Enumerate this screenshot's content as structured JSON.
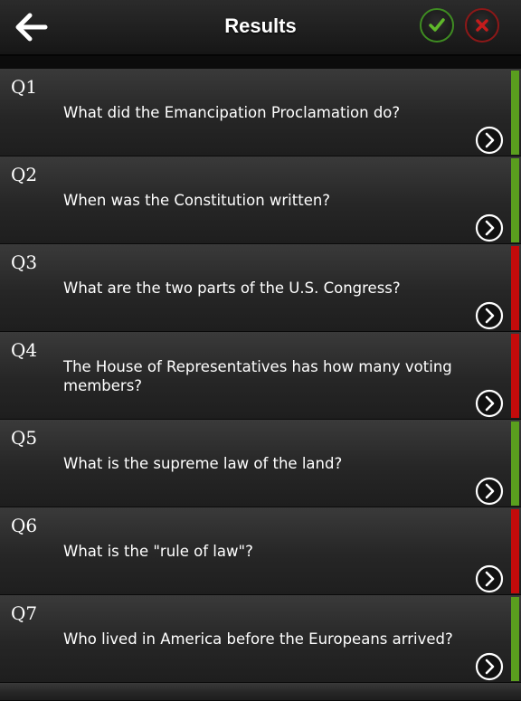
{
  "header": {
    "title": "Results",
    "back_icon": "arrow-left-icon",
    "correct_icon": "checkmark-icon",
    "wrong_icon": "x-icon"
  },
  "colors": {
    "correct": "#5a9e1e",
    "wrong": "#c30b0b"
  },
  "questions": [
    {
      "num": "Q1",
      "text": "What did the Emancipation Proclamation do?",
      "status": "correct"
    },
    {
      "num": "Q2",
      "text": "When was the Constitution written?",
      "status": "correct"
    },
    {
      "num": "Q3",
      "text": "What are the two parts of the U.S. Congress?",
      "status": "wrong"
    },
    {
      "num": "Q4",
      "text": "The House of Representatives has how many voting members?",
      "status": "wrong"
    },
    {
      "num": "Q5",
      "text": "What is the supreme law of the land?",
      "status": "correct"
    },
    {
      "num": "Q6",
      "text": "What is the \"rule of law\"?",
      "status": "wrong"
    },
    {
      "num": "Q7",
      "text": "Who lived in America before the Europeans arrived?",
      "status": "correct"
    }
  ]
}
